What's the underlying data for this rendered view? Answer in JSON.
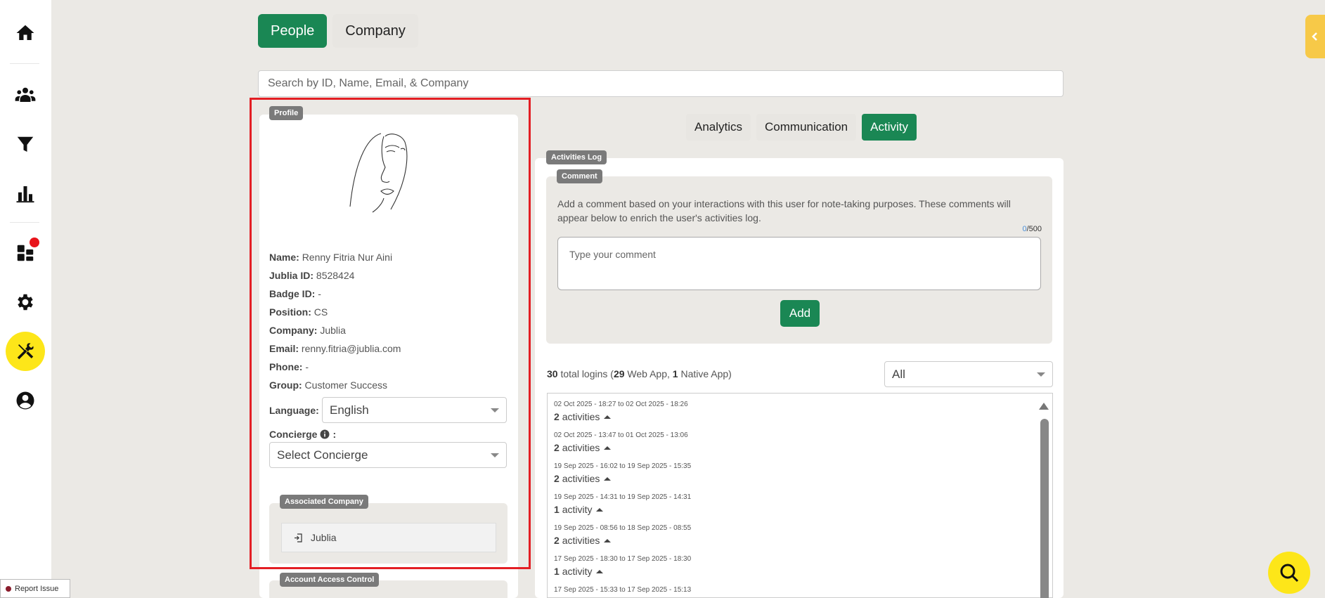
{
  "top_tabs": [
    {
      "label": "People",
      "active": true
    },
    {
      "label": "Company",
      "active": false
    }
  ],
  "search": {
    "placeholder": "Search by ID, Name, Email, & Company"
  },
  "profile": {
    "badge": "Profile",
    "fields": [
      {
        "label": "Name:",
        "value": "Renny Fitria Nur Aini"
      },
      {
        "label": "Jublia ID:",
        "value": "8528424"
      },
      {
        "label": "Badge ID:",
        "value": "-"
      },
      {
        "label": "Position:",
        "value": "CS"
      },
      {
        "label": "Company:",
        "value": "Jublia"
      },
      {
        "label": "Email:",
        "value": "renny.fitria@jublia.com"
      },
      {
        "label": "Phone:",
        "value": "-"
      },
      {
        "label": "Group:",
        "value": "Customer Success"
      }
    ],
    "language_label": "Language:",
    "language_value": "English",
    "concierge_label": "Concierge",
    "concierge_colon": ":",
    "concierge_placeholder": "Select Concierge",
    "associated_badge": "Associated Company",
    "associated_company": "Jublia",
    "access_badge": "Account Access Control"
  },
  "right_tabs": [
    {
      "label": "Analytics",
      "active": false
    },
    {
      "label": "Communication",
      "active": false
    },
    {
      "label": "Activity",
      "active": true
    }
  ],
  "activities": {
    "log_badge": "Activities Log",
    "comment_badge": "Comment",
    "comment_desc": "Add a comment based on your interactions with this user for note-taking purposes. These comments will appear below to enrich the user's activities log.",
    "counter_current": "0",
    "counter_max": "/500",
    "comment_placeholder": "Type your comment",
    "add_label": "Add",
    "logins_total": "30",
    "logins_text1": " total logins (",
    "logins_web": "29",
    "logins_text2": " Web App, ",
    "logins_native": "1",
    "logins_text3": " Native App)",
    "filter_value": "All",
    "entries": [
      {
        "date": "02 Oct 2025 - 18:27 to 02 Oct 2025 - 18:26",
        "count": "2",
        "unit": "activities"
      },
      {
        "date": "02 Oct 2025 - 13:47 to 01 Oct 2025 - 13:06",
        "count": "2",
        "unit": "activities"
      },
      {
        "date": "19 Sep 2025 - 16:02 to 19 Sep 2025 - 15:35",
        "count": "2",
        "unit": "activities"
      },
      {
        "date": "19 Sep 2025 - 14:31 to 19 Sep 2025 - 14:31",
        "count": "1",
        "unit": "activity"
      },
      {
        "date": "19 Sep 2025 - 08:56 to 18 Sep 2025 - 08:55",
        "count": "2",
        "unit": "activities"
      },
      {
        "date": "17 Sep 2025 - 18:30 to 17 Sep 2025 - 18:30",
        "count": "1",
        "unit": "activity"
      },
      {
        "date": "17 Sep 2025 - 15:33 to 17 Sep 2025 - 15:13",
        "count": "",
        "unit": ""
      }
    ]
  },
  "report_issue": "Report Issue"
}
